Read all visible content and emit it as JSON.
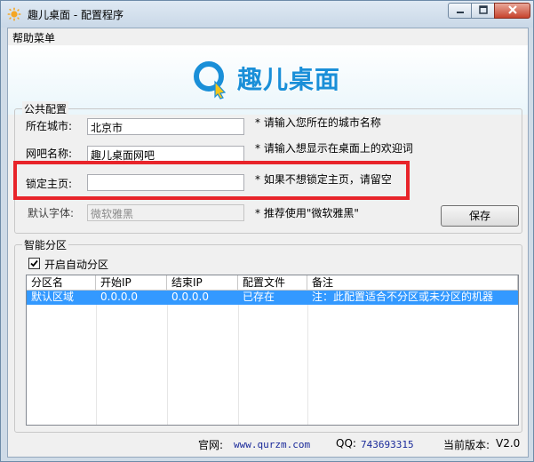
{
  "window": {
    "title": "趣儿桌面 - 配置程序"
  },
  "menu": {
    "help_label": "帮助菜单"
  },
  "banner": {
    "logo_text": "趣儿桌面",
    "brand_color": "#1a8fd8"
  },
  "public_config": {
    "group_title": "公共配置",
    "city_label": "所在城市:",
    "city_value": "北京市",
    "city_hint": "* 请输入您所在的城市名称",
    "netbar_label": "网吧名称:",
    "netbar_value": "趣儿桌面网吧",
    "netbar_hint": "* 请输入想显示在桌面上的欢迎词",
    "homepage_label": "锁定主页:",
    "homepage_value": "",
    "homepage_hint": "* 如果不想锁定主页，请留空",
    "font_label": "默认字体:",
    "font_value": "微软雅黑",
    "font_hint": "* 推荐使用\"微软雅黑\"",
    "save_label": "保存"
  },
  "smart_partition": {
    "group_title": "智能分区",
    "auto_label": "开启自动分区",
    "auto_checked": true,
    "columns": [
      "分区名",
      "开始IP",
      "结束IP",
      "配置文件",
      "备注"
    ],
    "rows": [
      {
        "name": "默认区域",
        "start_ip": "0.0.0.0",
        "end_ip": "0.0.0.0",
        "config": "已存在",
        "note": "注：此配置适合不分区或未分区的机器"
      }
    ]
  },
  "footer": {
    "website_label": "官网:",
    "website_value": "www.qurzm.com",
    "qq_label": "QQ:",
    "qq_value": "743693315",
    "version_label": "当前版本:",
    "version_value": "V2.0"
  },
  "highlight_color": "#e8242a"
}
